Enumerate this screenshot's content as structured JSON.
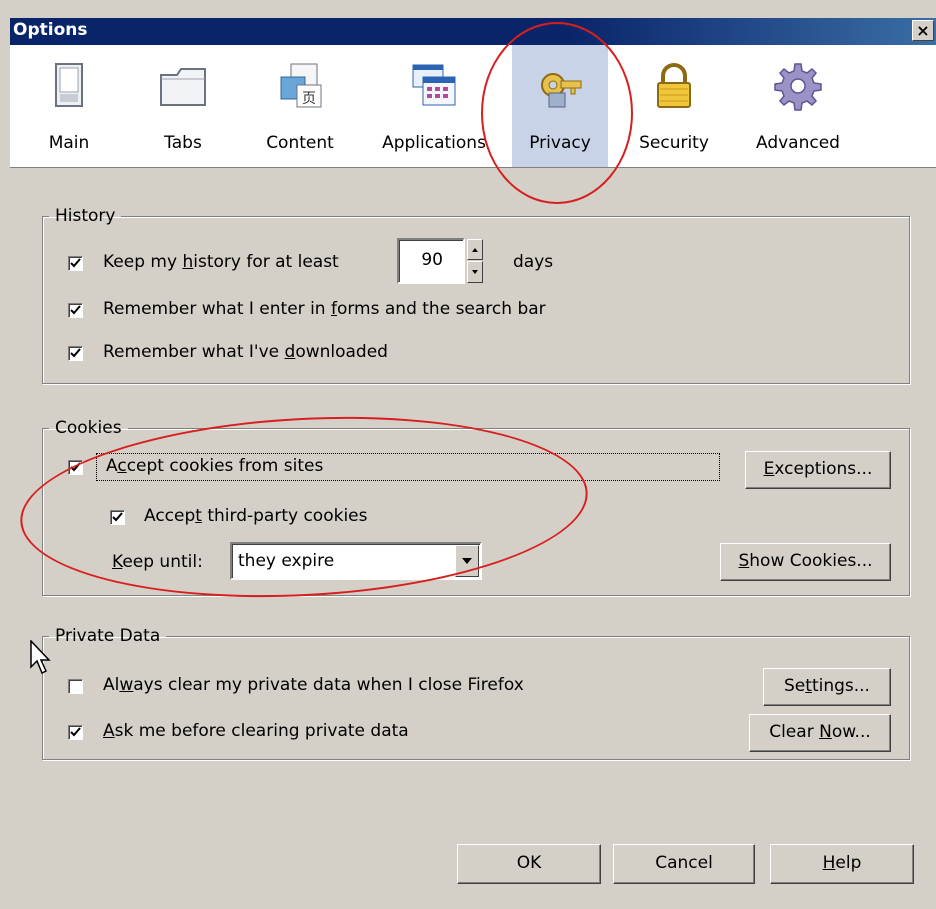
{
  "window": {
    "title": "Options",
    "close_glyph": "×"
  },
  "tabs": [
    {
      "label": "Main",
      "icon": "main-icon"
    },
    {
      "label": "Tabs",
      "icon": "tabs-icon"
    },
    {
      "label": "Content",
      "icon": "content-icon"
    },
    {
      "label": "Applications",
      "icon": "applications-icon"
    },
    {
      "label": "Privacy",
      "icon": "privacy-key-icon",
      "selected": true
    },
    {
      "label": "Security",
      "icon": "security-lock-icon"
    },
    {
      "label": "Advanced",
      "icon": "advanced-gear-icon"
    }
  ],
  "history": {
    "legend": "History",
    "keep_history": {
      "pre": "Keep my ",
      "ul": "h",
      "post": "istory for at least",
      "checked": true
    },
    "days_value": "90",
    "days_unit": "days",
    "remember_forms": {
      "pre": "Remember what I enter in ",
      "ul": "f",
      "post": "orms and the search bar",
      "checked": true
    },
    "remember_downloads": {
      "pre": "Remember what I've ",
      "ul": "d",
      "post": "ownloaded",
      "checked": true
    }
  },
  "cookies": {
    "legend": "Cookies",
    "accept_cookies": {
      "pre": "A",
      "ul": "c",
      "post": "cept cookies from sites",
      "checked": true
    },
    "accept_third_party": {
      "pre": "Accep",
      "ul": "t",
      "post": " third-party cookies",
      "checked": true
    },
    "keep_until": {
      "ul": "K",
      "post": "eep until:"
    },
    "keep_until_value": "they expire",
    "exceptions_button": {
      "ul": "E",
      "post": "xceptions..."
    },
    "show_cookies_button": {
      "ul": "S",
      "post": "how Cookies..."
    }
  },
  "private_data": {
    "legend": "Private Data",
    "always_clear": {
      "pre": "Al",
      "ul": "w",
      "post": "ays clear my private data when I close Firefox",
      "checked": false
    },
    "ask_before": {
      "ul": "A",
      "post": "sk me before clearing private data",
      "checked": true
    },
    "settings_button": {
      "pre": "Se",
      "ul": "t",
      "post": "tings..."
    },
    "clear_now_button": {
      "pre": "Clear ",
      "ul": "N",
      "post": "ow..."
    }
  },
  "footer": {
    "ok": "OK",
    "cancel": "Cancel",
    "help": {
      "ul": "H",
      "post": "elp"
    }
  },
  "annotation": {
    "color": "#d81f1f"
  },
  "colors": {
    "title_bar": "#0a246a",
    "dialog_bg": "#d4d0c8",
    "selected_tab": "#c9d3e8"
  }
}
